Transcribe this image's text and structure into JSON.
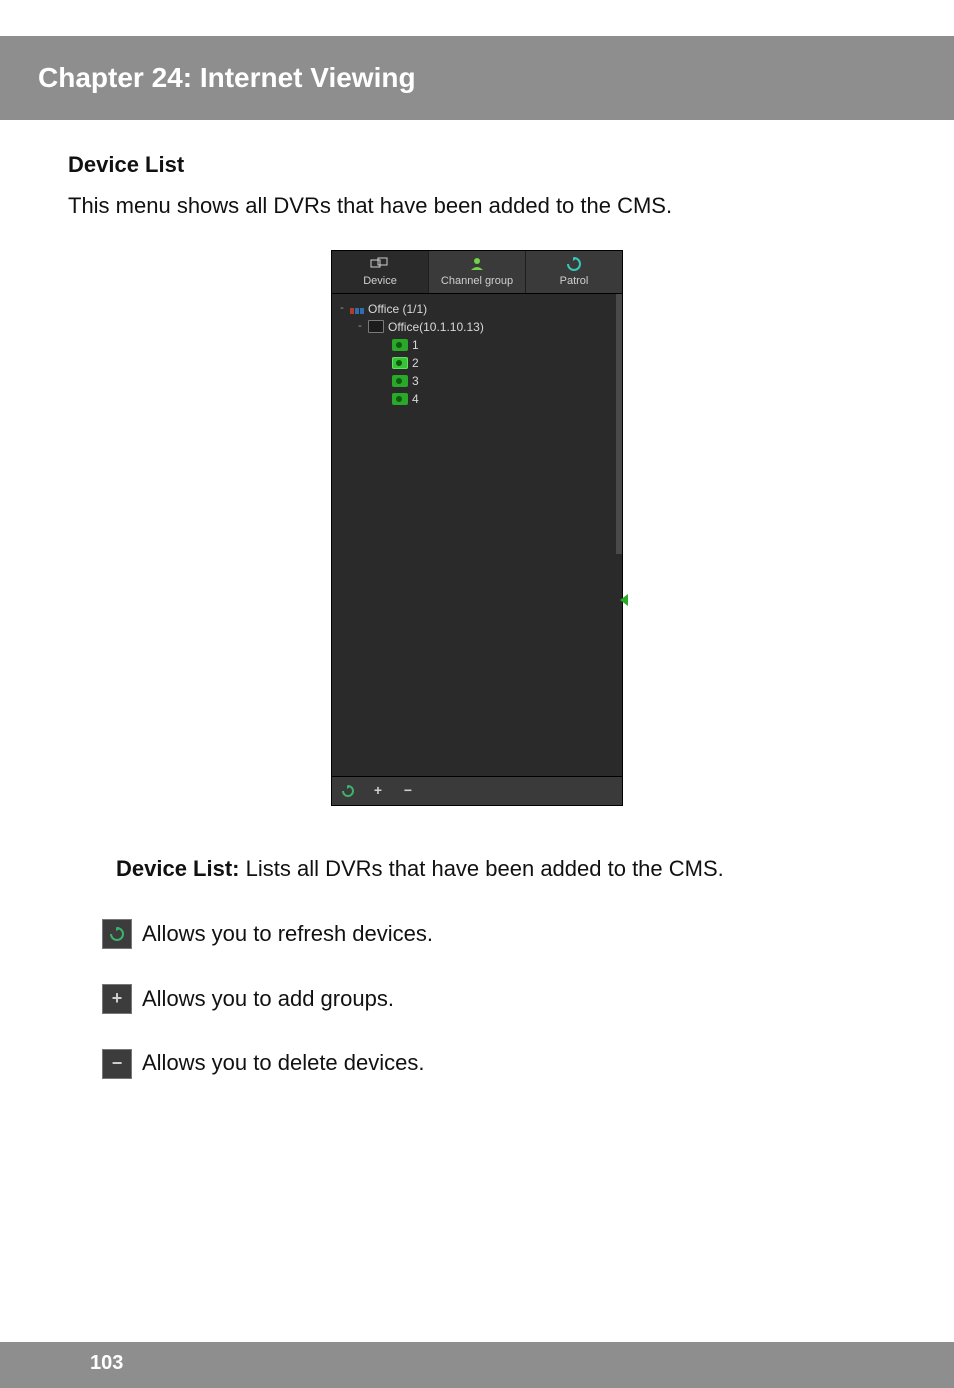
{
  "chapter": {
    "title": "Chapter 24: Internet Viewing"
  },
  "section": {
    "heading": "Device List",
    "intro": "This menu shows all DVRs that have been added to the CMS."
  },
  "panel_ui": {
    "tabs": {
      "device": "Device",
      "channel_group": "Channel group",
      "patrol": "Patrol"
    },
    "tree": {
      "group_label": "Office (1/1)",
      "device_label": "Office(10.1.10.13)",
      "channels": [
        "1",
        "2",
        "3",
        "4"
      ]
    }
  },
  "descriptions": {
    "device_list_bold": "Device List:",
    "device_list_text": " Lists all DVRs that have been added to the CMS.",
    "refresh": " Allows you to refresh devices.",
    "add": " Allows you to add groups.",
    "delete": " Allows you to delete devices."
  },
  "page_number": "103"
}
